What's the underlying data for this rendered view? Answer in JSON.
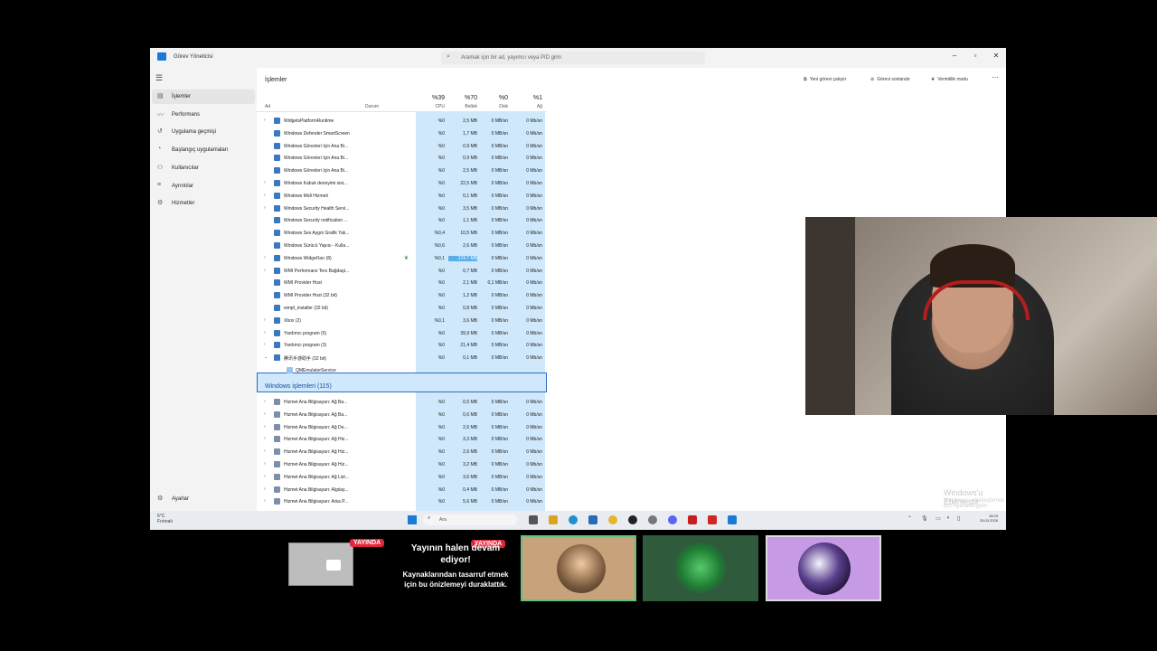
{
  "window": {
    "title": "Görev Yöneticisi",
    "search_placeholder": "Aramak için bir ad, yayımcı veya PID girin"
  },
  "sidebar": {
    "items": [
      {
        "label": "İşlemler",
        "icon": "processes-icon"
      },
      {
        "label": "Performans",
        "icon": "performance-icon"
      },
      {
        "label": "Uygulama geçmişi",
        "icon": "history-icon"
      },
      {
        "label": "Başlangıç uygulamaları",
        "icon": "startup-icon"
      },
      {
        "label": "Kullanıcılar",
        "icon": "users-icon"
      },
      {
        "label": "Ayrıntılar",
        "icon": "details-icon"
      },
      {
        "label": "Hizmetler",
        "icon": "services-icon"
      }
    ],
    "settings_label": "Ayarlar"
  },
  "main": {
    "title": "İşlemler",
    "toolbar": {
      "run_task": "Yeni görevi çalıştır",
      "end_task": "Görevi sonlandır",
      "efficiency": "Verimlilik modu",
      "more": "⋯"
    },
    "columns": {
      "name": "Ad",
      "status": "Durum",
      "cpu_pct": "%39",
      "cpu": "CPU",
      "mem_pct": "%70",
      "mem": "Bellek",
      "disk_pct": "%0",
      "disk": "Disk",
      "net_pct": "%1",
      "net": "Ağ"
    },
    "rows": [
      {
        "name": "WidgetsPlatformRuntime",
        "cpu": "%0",
        "mem": "2,5 MB",
        "disk": "0 MB/sn",
        "net": "0 Mb/sn",
        "expand": true
      },
      {
        "name": "Windows Defender SmartScreen",
        "cpu": "%0",
        "mem": "1,7 MB",
        "disk": "0 MB/sn",
        "net": "0 Mb/sn",
        "expand": false
      },
      {
        "name": "Windows Görevleri İçin Ana Bi...",
        "cpu": "%0",
        "mem": "0,9 MB",
        "disk": "0 MB/sn",
        "net": "0 Mb/sn",
        "expand": false
      },
      {
        "name": "Windows Görevleri İçin Ana Bi...",
        "cpu": "%0",
        "mem": "0,9 MB",
        "disk": "0 MB/sn",
        "net": "0 Mb/sn",
        "expand": false
      },
      {
        "name": "Windows Görevleri İçin Ana Bi...",
        "cpu": "%0",
        "mem": "2,5 MB",
        "disk": "0 MB/sn",
        "net": "0 Mb/sn",
        "expand": false
      },
      {
        "name": "Windows Kabuk deneyimi sist...",
        "cpu": "%0",
        "mem": "22,5 MB",
        "disk": "0 MB/sn",
        "net": "0 Mb/sn",
        "expand": true
      },
      {
        "name": "Windows Midi Hizmeti",
        "cpu": "%0",
        "mem": "0,1 MB",
        "disk": "0 MB/sn",
        "net": "0 Mb/sn",
        "expand": true
      },
      {
        "name": "Windows Security Health Servi...",
        "cpu": "%0",
        "mem": "3,5 MB",
        "disk": "0 MB/sn",
        "net": "0 Mb/sn",
        "expand": true
      },
      {
        "name": "Windows Security notification ...",
        "cpu": "%0",
        "mem": "1,1 MB",
        "disk": "0 MB/sn",
        "net": "0 Mb/sn",
        "expand": false
      },
      {
        "name": "Windows Ses Aygıtı Grafik Yalı...",
        "cpu": "%0,4",
        "mem": "10,5 MB",
        "disk": "0 MB/sn",
        "net": "0 Mb/sn",
        "expand": false
      },
      {
        "name": "Windows Sürücü Yapısı - Kulla...",
        "cpu": "%0,6",
        "mem": "2,6 MB",
        "disk": "0 MB/sn",
        "net": "0 Mb/sn",
        "expand": false
      },
      {
        "name": "Windows Widget'ları (8)",
        "cpu": "%0,1",
        "mem": "174,7 MB",
        "disk": "0 MB/sn",
        "net": "0 Mb/sn",
        "expand": true,
        "paused": true
      },
      {
        "name": "WMI Performans Ters Bağdaşt...",
        "cpu": "%0",
        "mem": "0,7 MB",
        "disk": "0 MB/sn",
        "net": "0 Mb/sn",
        "expand": true
      },
      {
        "name": "WMI Provider Host",
        "cpu": "%0",
        "mem": "2,1 MB",
        "disk": "0,1 MB/sn",
        "net": "0 Mb/sn",
        "expand": false
      },
      {
        "name": "WMI Provider Host (32 bit)",
        "cpu": "%0",
        "mem": "1,2 MB",
        "disk": "0 MB/sn",
        "net": "0 Mb/sn",
        "expand": false
      },
      {
        "name": "wmpf_installer (32 bit)",
        "cpu": "%0",
        "mem": "0,8 MB",
        "disk": "0 MB/sn",
        "net": "0 Mb/sn",
        "expand": false
      },
      {
        "name": "Xbox (2)",
        "cpu": "%0,1",
        "mem": "3,6 MB",
        "disk": "0 MB/sn",
        "net": "0 Mb/sn",
        "expand": true
      },
      {
        "name": "Yardımcı program (5)",
        "cpu": "%0",
        "mem": "39,9 MB",
        "disk": "0 MB/sn",
        "net": "0 Mb/sn",
        "expand": true
      },
      {
        "name": "Yardımcı program (3)",
        "cpu": "%0",
        "mem": "21,4 MB",
        "disk": "0 MB/sn",
        "net": "0 Mb/sn",
        "expand": true
      },
      {
        "name": "腾讯手游助手 (32 bit)",
        "cpu": "%0",
        "mem": "0,1 MB",
        "disk": "0 MB/sn",
        "net": "0 Mb/sn",
        "expand": true,
        "selected": true
      },
      {
        "name": "QMEmulatorService",
        "cpu": "",
        "mem": "",
        "disk": "",
        "net": "",
        "child": true
      }
    ],
    "section_title": "Windows işlemleri (115)",
    "win_rows": [
      {
        "name": "Hizmet Ana Bilgisayarı: Ağ Ba...",
        "cpu": "%0",
        "mem": "0,5 MB",
        "disk": "0 MB/sn",
        "net": "0 Mb/sn"
      },
      {
        "name": "Hizmet Ana Bilgisayarı: Ağ Ba...",
        "cpu": "%0",
        "mem": "0,6 MB",
        "disk": "0 MB/sn",
        "net": "0 Mb/sn"
      },
      {
        "name": "Hizmet Ana Bilgisayarı: Ağ De...",
        "cpu": "%0",
        "mem": "2,6 MB",
        "disk": "0 MB/sn",
        "net": "0 Mb/sn"
      },
      {
        "name": "Hizmet Ana Bilgisayarı: Ağ Hiz...",
        "cpu": "%0",
        "mem": "3,3 MB",
        "disk": "0 MB/sn",
        "net": "0 Mb/sn"
      },
      {
        "name": "Hizmet Ana Bilgisayarı: Ağ Hiz...",
        "cpu": "%0",
        "mem": "2,6 MB",
        "disk": "0 MB/sn",
        "net": "0 Mb/sn"
      },
      {
        "name": "Hizmet Ana Bilgisayarı: Ağ Hiz...",
        "cpu": "%0",
        "mem": "3,2 MB",
        "disk": "0 MB/sn",
        "net": "0 Mb/sn"
      },
      {
        "name": "Hizmet Ana Bilgisayarı: Ağ List...",
        "cpu": "%0",
        "mem": "3,6 MB",
        "disk": "0 MB/sn",
        "net": "0 Mb/sn"
      },
      {
        "name": "Hizmet Ana Bilgisayarı: Algılay...",
        "cpu": "%0",
        "mem": "0,4 MB",
        "disk": "0 MB/sn",
        "net": "0 Mb/sn"
      },
      {
        "name": "Hizmet Ana Bilgisayarı: Arka P...",
        "cpu": "%0",
        "mem": "5,6 MB",
        "disk": "0 MB/sn",
        "net": "0 Mb/sn"
      }
    ],
    "activation_title": "Windows'u Etkinleştir",
    "activation_sub": "Windows'u etkinleştirmek için Ayarlar'a gidin"
  },
  "taskbar": {
    "weather_temp": "6°C",
    "weather_desc": "Fırtınalı",
    "search_label": "Ara",
    "time": "18:29",
    "date": "25.03.2026"
  },
  "stream": {
    "live_badge": "YAYINDA",
    "live_badge2": "YAYINDA",
    "msg_title": "Yayının halen devam ediyor!",
    "msg_body": "Kaynaklarından tasarruf etmek için bu önizlemeyi duraklattık."
  },
  "colors": {
    "accent": "#1a7ad6",
    "highlight": "#cfe8fb",
    "live": "#e2263a"
  }
}
